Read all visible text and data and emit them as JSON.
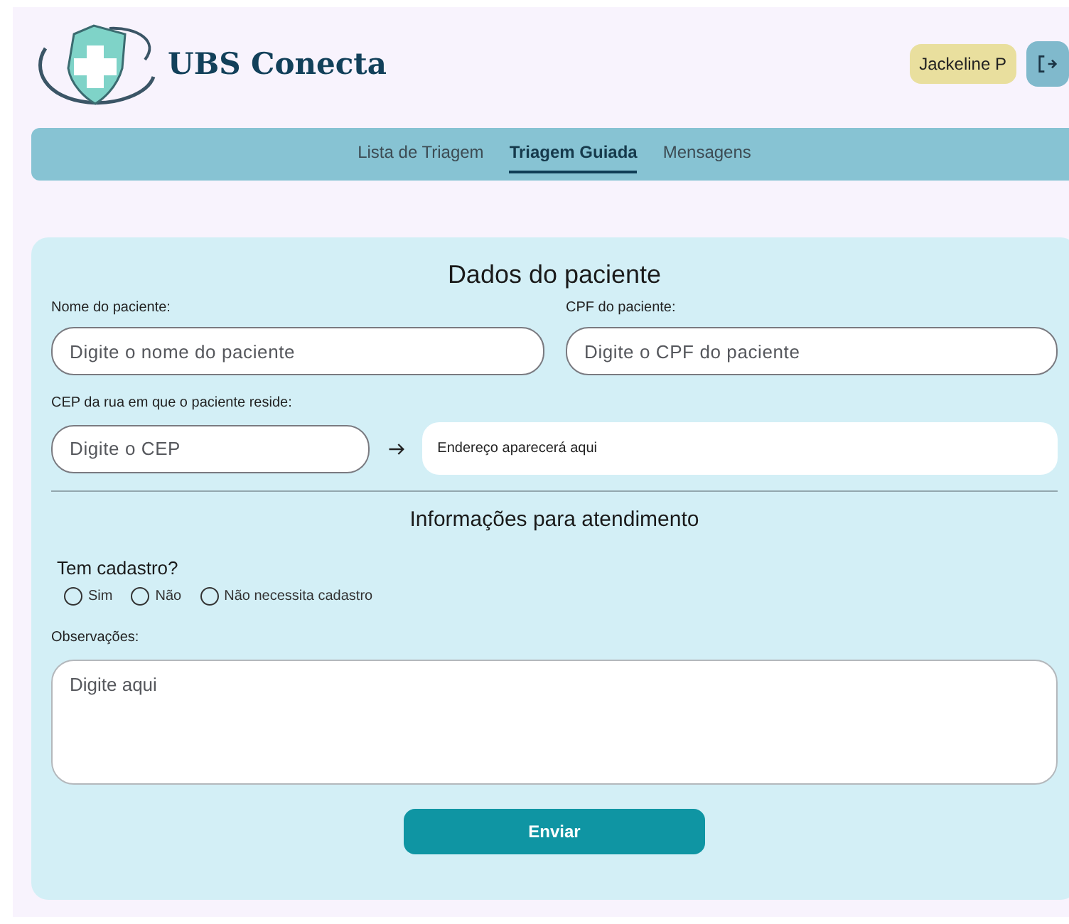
{
  "header": {
    "title": "UBS Conecta",
    "user": "Jackeline P"
  },
  "nav": [
    {
      "label": "Lista de Triagem",
      "selected": false
    },
    {
      "label": "Triagem Guiada",
      "selected": true
    },
    {
      "label": "Mensagens",
      "selected": false
    }
  ],
  "patient": {
    "title": "Dados do paciente",
    "name": {
      "label": "Nome do paciente:",
      "placeholder": "Digite o nome do paciente"
    },
    "cpf": {
      "label": "CPF do paciente:",
      "placeholder": "Digite o CPF do paciente"
    },
    "cep": {
      "label": "CEP da rua em que o paciente reside:",
      "placeholder": "Digite o CEP"
    },
    "address": "Endereço aparecerá aqui"
  },
  "care": {
    "title": "Informações para atendimento",
    "question": "Tem cadastro?",
    "options": [
      {
        "label": "Sim",
        "selected": false
      },
      {
        "label": "Não",
        "selected": false
      },
      {
        "label": "Não necessita cadastro",
        "selected": false
      }
    ],
    "notes": {
      "label": "Observações:",
      "placeholder": "Digite aqui"
    },
    "submit": "Enviar"
  }
}
